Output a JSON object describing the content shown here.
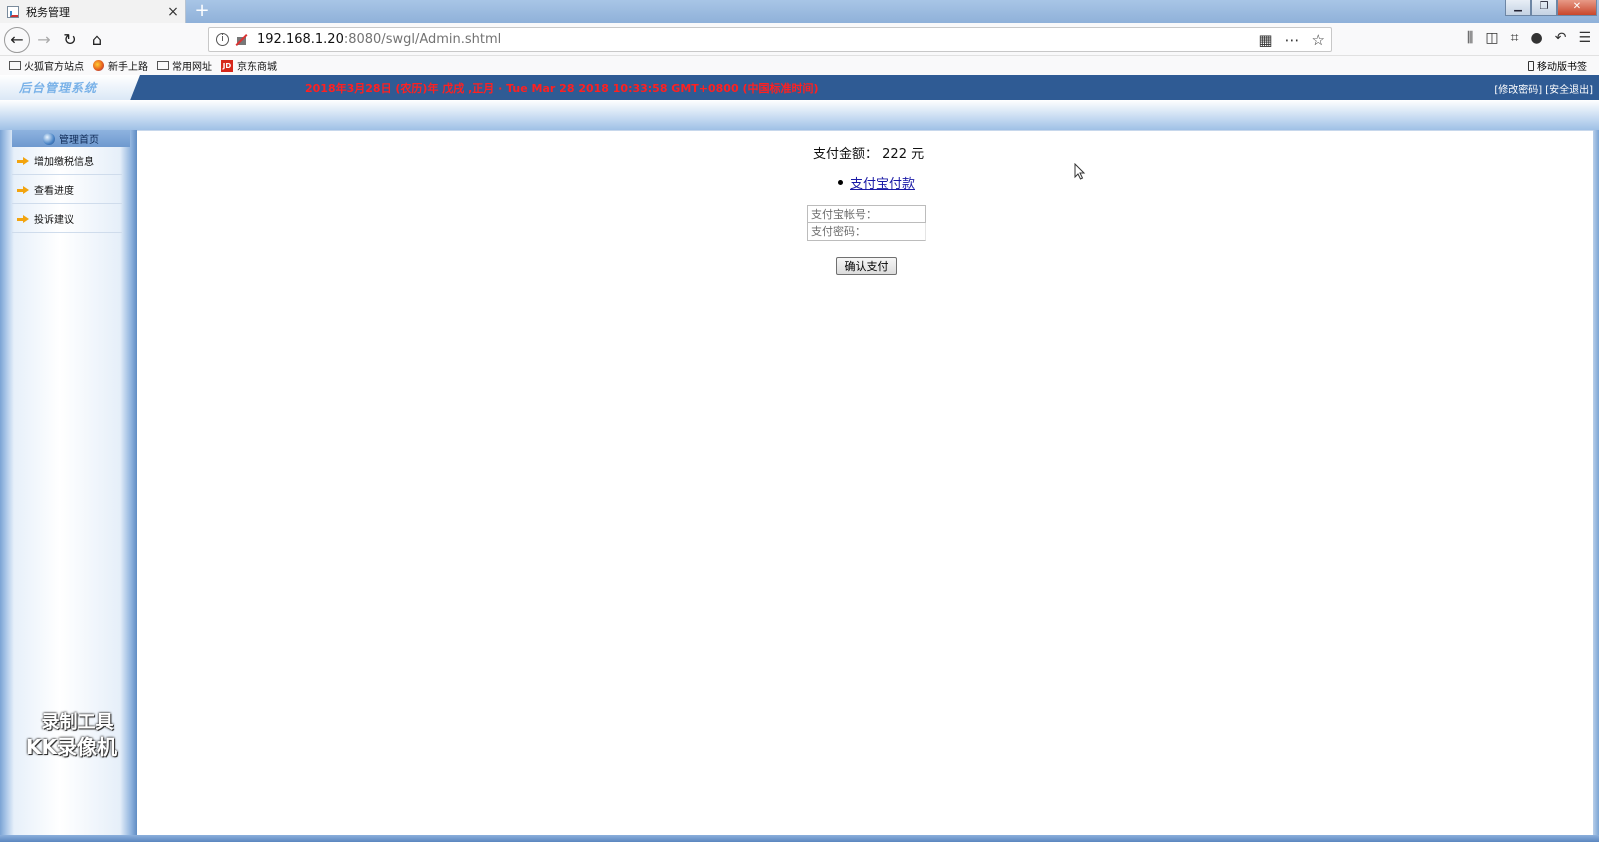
{
  "browser": {
    "tab_title": "税务管理",
    "tab_close": "×",
    "new_tab": "+",
    "url_host": "192.168.1.20",
    "url_rest": ":8080/swgl/Admin.shtml",
    "bookmarks": [
      {
        "label": "火狐官方站点",
        "icon": "folder-icon"
      },
      {
        "label": "新手上路",
        "icon": "firefox-icon"
      },
      {
        "label": "常用网址",
        "icon": "folder-icon"
      },
      {
        "label": "京东商城",
        "icon": "jd-icon",
        "icon_text": "JD"
      }
    ],
    "mobile_bookmarks": "移动版书签"
  },
  "header": {
    "logo": "后台管理系统",
    "marquee": "2018年3月28日 (农历)年 戊戌 ,正月 · Tue Mar 28 2018 10:33:58 GMT+0800 (中国标准时间)",
    "change_password": "[修改密码]",
    "logout": "[安全退出]"
  },
  "sidebar": {
    "title": "管理首页",
    "items": [
      {
        "label": "增加缴税信息"
      },
      {
        "label": "查看进度"
      },
      {
        "label": "投诉建议"
      }
    ]
  },
  "watermark": {
    "line1": "录制工具",
    "line2": "KK录像机"
  },
  "main": {
    "amount_label": "支付金额：",
    "amount_value": "222",
    "amount_unit": "元",
    "pay_option": "支付宝付款",
    "account_placeholder": "支付宝帐号：",
    "password_placeholder": "支付密码：",
    "confirm_label": "确认支付"
  }
}
